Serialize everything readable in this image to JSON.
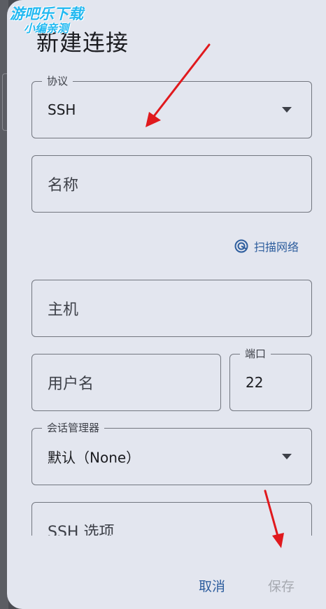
{
  "watermark": {
    "line1": "游吧乐下载",
    "line2": "小编亲测"
  },
  "dialog": {
    "title": "新建连接",
    "protocol": {
      "label": "协议",
      "value": "SSH"
    },
    "name": {
      "placeholder": "名称"
    },
    "scan": {
      "label": "扫描网络",
      "icon": "radar-scan-icon"
    },
    "host": {
      "placeholder": "主机"
    },
    "username": {
      "placeholder": "用户名"
    },
    "port": {
      "label": "端口",
      "value": "22"
    },
    "session_manager": {
      "label": "会话管理器",
      "value": "默认（None）"
    },
    "ssh_options": {
      "placeholder": "SSH 选项"
    },
    "buttons": {
      "cancel": "取消",
      "save": "保存"
    }
  },
  "colors": {
    "accent": "#2e5e9e",
    "disabled": "#a6a9b0",
    "surface": "#e3e6ef",
    "annotation_arrow": "#e0191d"
  }
}
